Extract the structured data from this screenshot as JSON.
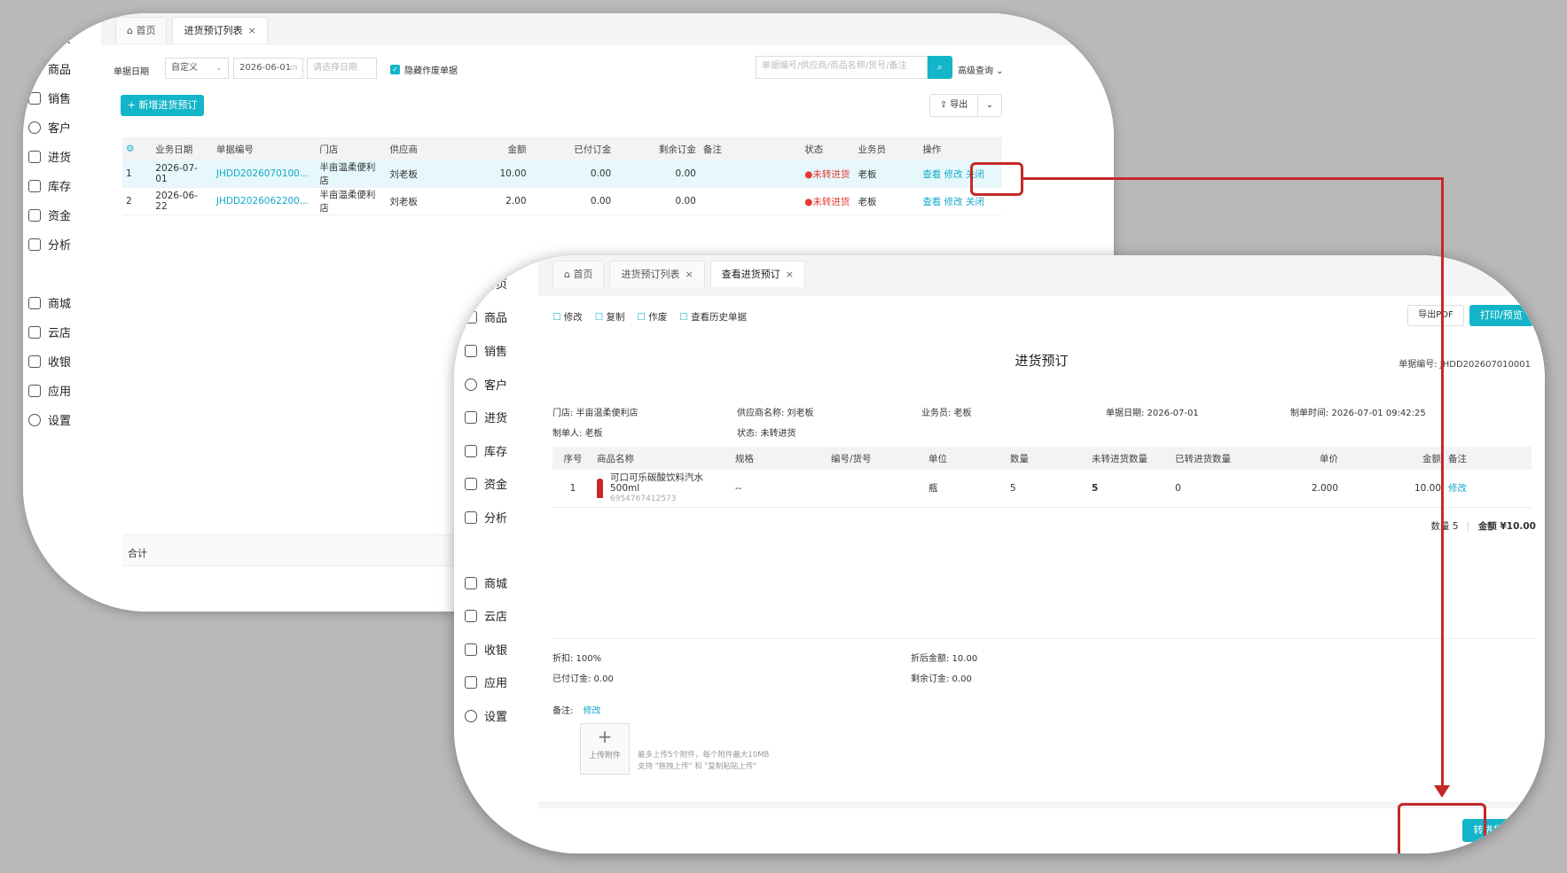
{
  "nav": [
    {
      "id": "home",
      "label": "首页"
    },
    {
      "id": "goods",
      "label": "商品"
    },
    {
      "id": "sales",
      "label": "销售"
    },
    {
      "id": "customer",
      "label": "客户"
    },
    {
      "id": "purchase",
      "label": "进货"
    },
    {
      "id": "stock",
      "label": "库存"
    },
    {
      "id": "fund",
      "label": "资金"
    },
    {
      "id": "analysis",
      "label": "分析"
    },
    {
      "id": "mall",
      "label": "商城"
    },
    {
      "id": "cloud",
      "label": "云店"
    },
    {
      "id": "cashier",
      "label": "收银"
    },
    {
      "id": "apps",
      "label": "应用"
    },
    {
      "id": "settings",
      "label": "设置"
    }
  ],
  "list": {
    "tabs": {
      "home": "首页",
      "list": "进货预订列表"
    },
    "filter": {
      "date_label": "单据日期",
      "range_value": "自定义",
      "start_date": "2026-06-01",
      "end_placeholder": "请选择日期",
      "hide_void": "隐藏作废单据",
      "search_placeholder": "单据编号/供应商/商品名称/货号/备注",
      "advanced": "高级查询"
    },
    "add_button": "+ 新增进货预订",
    "export": "导出",
    "columns": [
      "业务日期",
      "单据编号",
      "门店",
      "供应商",
      "金额",
      "已付订金",
      "剩余订金",
      "备注",
      "状态",
      "业务员",
      "操作"
    ],
    "rows": [
      {
        "no": "1",
        "date": "2026-07-01",
        "code": "JHDD2026070100...",
        "store": "半亩温柔便利店",
        "supplier": "刘老板",
        "amount": "10.00",
        "paid": "0.00",
        "remain": "0.00",
        "note": "",
        "status": "未转进货",
        "staff": "老板",
        "a1": "查看",
        "a2": "修改",
        "a3": "关闭"
      },
      {
        "no": "2",
        "date": "2026-06-22",
        "code": "JHDD2026062200...",
        "store": "半亩温柔便利店",
        "supplier": "刘老板",
        "amount": "2.00",
        "paid": "0.00",
        "remain": "0.00",
        "note": "",
        "status": "未转进货",
        "staff": "老板",
        "a1": "查看",
        "a2": "修改",
        "a3": "关闭"
      }
    ],
    "total_label": "合计"
  },
  "detail": {
    "tabs": {
      "home": "首页",
      "list": "进货预订列表",
      "view": "查看进货预订"
    },
    "toolbar": {
      "edit": "修改",
      "copy": "复制",
      "void": "作废",
      "history": "查看历史单据",
      "export_pdf": "导出PDF",
      "print": "打印/预览"
    },
    "title": "进货预订",
    "doc_no_label": "单据编号:",
    "doc_no": "JHDD202607010001",
    "info": {
      "store": "门店: 半亩温柔便利店",
      "supplier": "供应商名称: 刘老板",
      "staff": "业务员: 老板",
      "date": "单据日期: 2026-07-01",
      "created": "制单时间: 2026-07-01 09:42:25",
      "maker": "制单人: 老板",
      "status": "状态: 未转进货"
    },
    "columns": [
      "序号",
      "商品名称",
      "规格",
      "编号/货号",
      "单位",
      "数量",
      "未转进货数量",
      "已转进货数量",
      "单价",
      "金额",
      "备注"
    ],
    "item": {
      "no": "1",
      "name": "可口可乐碳酸饮料汽水",
      "spec_line": "500ml",
      "barcode": "6954767412573",
      "spec": "--",
      "code": "",
      "unit": "瓶",
      "qty": "5",
      "unconverted": "5",
      "converted": "0",
      "price": "2.000",
      "amount": "10.00",
      "edit": "修改"
    },
    "summary": {
      "qty": "数量 5",
      "amount": "金额 ¥10.00"
    },
    "footer": {
      "discount": "折扣: 100%",
      "after_discount": "折后金额: 10.00",
      "paid": "已付订金: 0.00",
      "remain": "剩余订金: 0.00",
      "note_label": "备注:",
      "note_edit": "修改",
      "upload": "上传附件",
      "upload_hint1": "最多上传5个附件，每个附件最大10MB",
      "upload_hint2": "支持 \"拖拽上传\" 和 \"复制粘贴上传\""
    },
    "convert_button": "转进货",
    "convert_link": "转进"
  },
  "colors": {
    "accent": "#13b5c8",
    "highlight": "#c62828"
  }
}
